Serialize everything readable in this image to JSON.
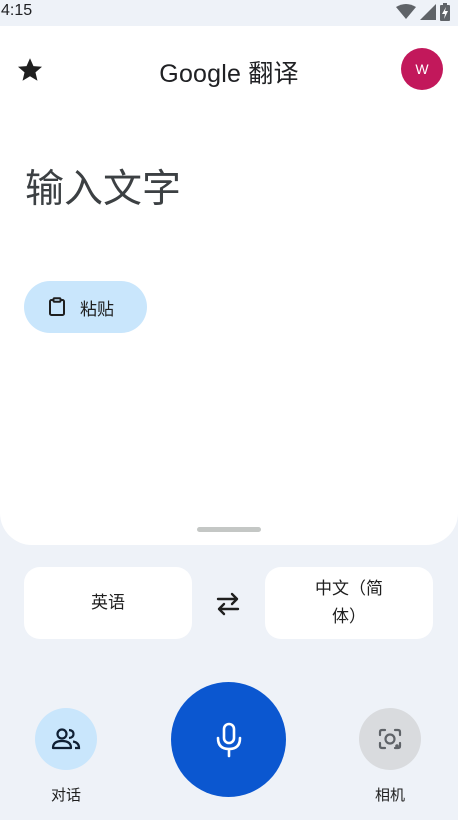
{
  "status_bar": {
    "time": "4:15",
    "icons": [
      "wifi-icon",
      "signal-icon",
      "battery-charging-icon"
    ]
  },
  "header": {
    "brand": "Google",
    "product": "翻译",
    "avatar_initial": "W",
    "avatar_color": "#c2185b",
    "favorites_icon": "star-icon"
  },
  "input": {
    "placeholder": "输入文字"
  },
  "paste": {
    "label": "粘贴",
    "icon": "clipboard-icon"
  },
  "languages": {
    "source": "英语",
    "target_line1": "中文（简",
    "target_line2": "体）",
    "swap_icon": "swap-arrows-icon"
  },
  "bottom_bar": {
    "conversation": {
      "label": "对话",
      "icon": "people-icon"
    },
    "voice": {
      "icon": "mic-icon"
    },
    "camera": {
      "label": "相机",
      "icon": "camera-lens-icon"
    }
  },
  "colors": {
    "accent": "#0b57d0",
    "paste_bg": "#c9e6fc",
    "page_bg": "#eef2f8"
  }
}
